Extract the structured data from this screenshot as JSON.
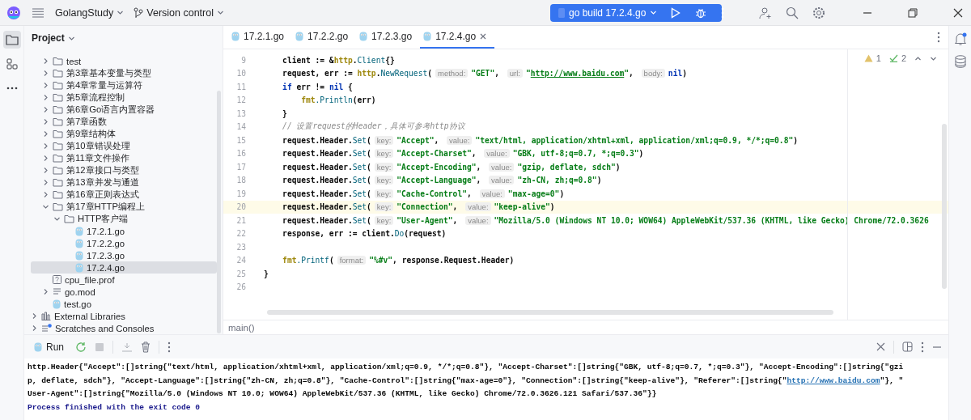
{
  "title_bar": {
    "project": "GolangStudy",
    "vcs": "Version control",
    "run_config": "go build 17.2.4.go"
  },
  "tool_strip": [
    {
      "kind": "project",
      "selected": true
    },
    {
      "kind": "structure",
      "selected": false
    },
    {
      "kind": "more",
      "selected": false
    }
  ],
  "sidebar": {
    "title": "Project",
    "file_tree": [
      {
        "label": "test",
        "kind": "folder",
        "expanded": false,
        "selected": false
      },
      {
        "label": "第3章基本变量与类型",
        "kind": "folder",
        "expanded": false,
        "selected": false
      },
      {
        "label": "第4章常量与运算符",
        "kind": "folder",
        "expanded": false,
        "selected": false
      },
      {
        "label": "第5章流程控制",
        "kind": "folder",
        "expanded": false,
        "selected": false
      },
      {
        "label": "第6章Go语言内置容器",
        "kind": "folder",
        "expanded": false,
        "selected": false
      },
      {
        "label": "第7章函数",
        "kind": "folder",
        "expanded": false,
        "selected": false
      },
      {
        "label": "第9章结构体",
        "kind": "folder",
        "expanded": false,
        "selected": false
      },
      {
        "label": "第10章错误处理",
        "kind": "folder",
        "expanded": false,
        "selected": false
      },
      {
        "label": "第11章文件操作",
        "kind": "folder",
        "expanded": false,
        "selected": false
      },
      {
        "label": "第12章接口与类型",
        "kind": "folder",
        "expanded": false,
        "selected": false
      },
      {
        "label": "第13章并发与通道",
        "kind": "folder",
        "expanded": false,
        "selected": false
      },
      {
        "label": "第16章正则表达式",
        "kind": "folder",
        "expanded": false,
        "selected": false
      },
      {
        "label": "第17章HTTP编程上",
        "kind": "folder",
        "expanded": true,
        "selected": false,
        "children": [
          {
            "label": "HTTP客户端",
            "kind": "folder",
            "expanded": true,
            "selected": false,
            "children": [
              {
                "label": "17.2.1.go",
                "kind": "gofile",
                "selected": false
              },
              {
                "label": "17.2.2.go",
                "kind": "gofile",
                "selected": false
              },
              {
                "label": "17.2.3.go",
                "kind": "gofile",
                "selected": false
              },
              {
                "label": "17.2.4.go",
                "kind": "gofile",
                "selected": true
              }
            ]
          }
        ]
      },
      {
        "label": "cpu_file.prof",
        "kind": "prof",
        "selected": false
      },
      {
        "label": "go.mod",
        "kind": "mod",
        "expanded": false,
        "selected": false
      },
      {
        "label": "test.go",
        "kind": "gofile",
        "selected": false
      }
    ],
    "root_items": [
      {
        "label": "External Libraries",
        "kind": "library",
        "expanded": false,
        "selected": false
      },
      {
        "label": "Scratches and Consoles",
        "kind": "scratches",
        "expanded": false,
        "selected": false
      }
    ]
  },
  "editor": {
    "tabs": [
      {
        "label": "17.2.1.go",
        "selected": false
      },
      {
        "label": "17.2.2.go",
        "selected": false
      },
      {
        "label": "17.2.3.go",
        "selected": false
      },
      {
        "label": "17.2.4.go",
        "selected": true
      }
    ],
    "inspections": {
      "warnings": "1",
      "checks": "2"
    },
    "lines": [
      {
        "number": "9",
        "current": false,
        "tokens": [
          {
            "kind": "plain",
            "text": "    client := &"
          },
          {
            "kind": "pkg",
            "text": "http"
          },
          {
            "kind": "plain",
            "text": "."
          },
          {
            "kind": "call",
            "text": "Client"
          },
          {
            "kind": "plain",
            "text": "{}"
          }
        ]
      },
      {
        "number": "10",
        "current": false,
        "tokens": [
          {
            "kind": "plain",
            "text": "    request, err := "
          },
          {
            "kind": "pkg",
            "text": "http"
          },
          {
            "kind": "plain",
            "text": "."
          },
          {
            "kind": "call",
            "text": "NewRequest"
          },
          {
            "kind": "plain",
            "text": "("
          },
          {
            "kind": "hint",
            "text": "method:"
          },
          {
            "kind": "str",
            "text": "\"GET\""
          },
          {
            "kind": "plain",
            "text": ", "
          },
          {
            "kind": "hint",
            "text": "url:"
          },
          {
            "kind": "str",
            "text": "\""
          },
          {
            "kind": "url",
            "text": "http://www.baidu.com"
          },
          {
            "kind": "str",
            "text": "\""
          },
          {
            "kind": "plain",
            "text": ", "
          },
          {
            "kind": "hint",
            "text": "body:"
          },
          {
            "kind": "kw",
            "text": "nil"
          },
          {
            "kind": "plain",
            "text": ")"
          }
        ]
      },
      {
        "number": "11",
        "current": false,
        "tokens": [
          {
            "kind": "kw",
            "text": "    if"
          },
          {
            "kind": "plain",
            "text": " err != "
          },
          {
            "kind": "kw",
            "text": "nil"
          },
          {
            "kind": "plain",
            "text": " {"
          }
        ]
      },
      {
        "number": "12",
        "current": false,
        "tokens": [
          {
            "kind": "pkg",
            "text": "        fmt"
          },
          {
            "kind": "call",
            "text": ".Println"
          },
          {
            "kind": "plain",
            "text": "(err)"
          }
        ]
      },
      {
        "number": "13",
        "current": false,
        "tokens": [
          {
            "kind": "plain",
            "text": "    }"
          }
        ]
      },
      {
        "number": "14",
        "current": false,
        "tokens": [
          {
            "kind": "comment",
            "text": "    // 设置request的Header，具体可参考http协议"
          }
        ]
      },
      {
        "number": "15",
        "current": false,
        "tokens": [
          {
            "kind": "plain",
            "text": "    request.Header."
          },
          {
            "kind": "call",
            "text": "Set"
          },
          {
            "kind": "plain",
            "text": "("
          },
          {
            "kind": "hint",
            "text": "key:"
          },
          {
            "kind": "str",
            "text": "\"Accept\""
          },
          {
            "kind": "plain",
            "text": ", "
          },
          {
            "kind": "hint",
            "text": "value:"
          },
          {
            "kind": "str",
            "text": "\"text/html, application/xhtml+xml, application/xml;q=0.9, */*;q=0.8\""
          },
          {
            "kind": "plain",
            "text": ")"
          }
        ]
      },
      {
        "number": "16",
        "current": false,
        "tokens": [
          {
            "kind": "plain",
            "text": "    request.Header."
          },
          {
            "kind": "call",
            "text": "Set"
          },
          {
            "kind": "plain",
            "text": "("
          },
          {
            "kind": "hint",
            "text": "key:"
          },
          {
            "kind": "str",
            "text": "\"Accept-Charset\""
          },
          {
            "kind": "plain",
            "text": ", "
          },
          {
            "kind": "hint",
            "text": "value:"
          },
          {
            "kind": "str",
            "text": "\"GBK, utf-8;q=0.7, *;q=0.3\""
          },
          {
            "kind": "plain",
            "text": ")"
          }
        ]
      },
      {
        "number": "17",
        "current": false,
        "tokens": [
          {
            "kind": "plain",
            "text": "    request.Header."
          },
          {
            "kind": "call",
            "text": "Set"
          },
          {
            "kind": "plain",
            "text": "("
          },
          {
            "kind": "hint",
            "text": "key:"
          },
          {
            "kind": "str",
            "text": "\"Accept-Encoding\""
          },
          {
            "kind": "plain",
            "text": ", "
          },
          {
            "kind": "hint",
            "text": "value:"
          },
          {
            "kind": "str",
            "text": "\"gzip, deflate, sdch\""
          },
          {
            "kind": "plain",
            "text": ")"
          }
        ]
      },
      {
        "number": "18",
        "current": false,
        "tokens": [
          {
            "kind": "plain",
            "text": "    request.Header."
          },
          {
            "kind": "call",
            "text": "Set"
          },
          {
            "kind": "plain",
            "text": "("
          },
          {
            "kind": "hint",
            "text": "key:"
          },
          {
            "kind": "str",
            "text": "\"Accept-Language\""
          },
          {
            "kind": "plain",
            "text": ", "
          },
          {
            "kind": "hint",
            "text": "value:"
          },
          {
            "kind": "str",
            "text": "\"zh-CN, zh;q=0.8\""
          },
          {
            "kind": "plain",
            "text": ")"
          }
        ]
      },
      {
        "number": "19",
        "current": false,
        "tokens": [
          {
            "kind": "plain",
            "text": "    request.Header."
          },
          {
            "kind": "call",
            "text": "Set"
          },
          {
            "kind": "plain",
            "text": "("
          },
          {
            "kind": "hint",
            "text": "key:"
          },
          {
            "kind": "str",
            "text": "\"Cache-Control\""
          },
          {
            "kind": "plain",
            "text": ", "
          },
          {
            "kind": "hint",
            "text": "value:"
          },
          {
            "kind": "str",
            "text": "\"max-age=0\""
          },
          {
            "kind": "plain",
            "text": ")"
          }
        ]
      },
      {
        "number": "20",
        "current": true,
        "tokens": [
          {
            "kind": "plain",
            "text": "    request.Header."
          },
          {
            "kind": "call",
            "text": "Set"
          },
          {
            "kind": "plain",
            "text": "("
          },
          {
            "kind": "hint",
            "text": "key:"
          },
          {
            "kind": "str",
            "text": "\"Connection\""
          },
          {
            "kind": "plain",
            "text": ", "
          },
          {
            "kind": "hint",
            "text": "value:"
          },
          {
            "kind": "str",
            "text": "\"keep-alive\""
          },
          {
            "kind": "plain",
            "text": ")"
          }
        ]
      },
      {
        "number": "21",
        "current": false,
        "tokens": [
          {
            "kind": "plain",
            "text": "    request.Header."
          },
          {
            "kind": "call",
            "text": "Set"
          },
          {
            "kind": "plain",
            "text": "("
          },
          {
            "kind": "hint",
            "text": "key:"
          },
          {
            "kind": "str",
            "text": "\"User-Agent\""
          },
          {
            "kind": "plain",
            "text": ", "
          },
          {
            "kind": "hint",
            "text": "value:"
          },
          {
            "kind": "str",
            "text": "\"Mozilla/5.0 (Windows NT 10.0; WOW64) AppleWebKit/537.36 (KHTML, like Gecko) Chrome/72.0.3626"
          }
        ]
      },
      {
        "number": "22",
        "current": false,
        "tokens": [
          {
            "kind": "plain",
            "text": "    response, err := client."
          },
          {
            "kind": "call",
            "text": "Do"
          },
          {
            "kind": "plain",
            "text": "(request)"
          }
        ]
      },
      {
        "number": "23",
        "current": false
      },
      {
        "number": "24",
        "current": false,
        "tokens": [
          {
            "kind": "pkg",
            "text": "    fmt"
          },
          {
            "kind": "call",
            "text": ".Printf"
          },
          {
            "kind": "plain",
            "text": "("
          },
          {
            "kind": "hint",
            "text": "format:"
          },
          {
            "kind": "str",
            "text": "\"%#v\""
          },
          {
            "kind": "plain",
            "text": ", response.Request.Header)"
          }
        ]
      },
      {
        "number": "25",
        "current": false,
        "tokens": [
          {
            "kind": "plain",
            "text": "}"
          }
        ]
      },
      {
        "number": "26",
        "current": false
      }
    ],
    "breadcrumb": "main()"
  },
  "run_panel": {
    "tab": "Run",
    "output": [
      [
        {
          "kind": "plain",
          "text": "http.Header{\"Accept\":[]string{\"text/html, application/xhtml+xml, application/xml;q=0.9, */*;q=0.8\"}, \"Accept-Charset\":[]string{\"GBK, utf-8;q=0.7, *;q=0.3\"}, \"Accept-Encoding\":[]string{\"gzi"
        }
      ],
      [
        {
          "kind": "plain",
          "text": "p, deflate, sdch\"}, \"Accept-Language\":[]string{\"zh-CN, zh;q=0.8\"}, \"Cache-Control\":[]string{\"max-age=0\"}, \"Connection\":[]string{\"keep-alive\"}, \"Referer\":[]string{\""
        },
        {
          "kind": "link",
          "text": "http://www.baidu.com"
        },
        {
          "kind": "plain",
          "text": "\"}, \""
        }
      ],
      [
        {
          "kind": "plain",
          "text": "User-Agent\":[]string{\"Mozilla/5.0 (Windows NT 10.0; WOW64) AppleWebKit/537.36 (KHTML, like Gecko) Chrome/72.0.3626.121 Safari/537.36\"}}"
        }
      ]
    ],
    "exit_message": "Process finished with the exit code 0"
  }
}
